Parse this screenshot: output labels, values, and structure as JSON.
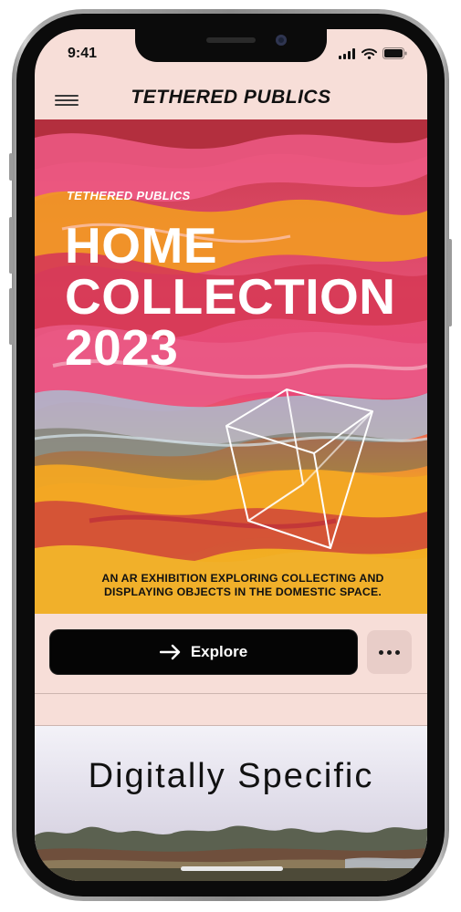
{
  "status_bar": {
    "time": "9:41"
  },
  "header": {
    "title": "TETHERED PUBLICS",
    "menu_icon": "hamburger-menu-icon"
  },
  "hero": {
    "eyebrow": "TETHERED PUBLICS",
    "title_lines": [
      "HOME",
      "COLLECTION",
      "2023"
    ],
    "caption_lines": [
      "AN AR EXHIBITION EXPLORING COLLECTING AND",
      "DISPLAYING OBJECTS IN THE DOMESTIC SPACE."
    ],
    "colors": {
      "pink": "#e8456e",
      "orange": "#f0a01e",
      "red": "#c82a3a",
      "blue": "#a9c2d4"
    }
  },
  "actions": {
    "explore_label": "Explore",
    "explore_icon": "arrow-right-icon",
    "more_icon": "more-horizontal-icon"
  },
  "card2": {
    "title": "Digitally Specific"
  }
}
